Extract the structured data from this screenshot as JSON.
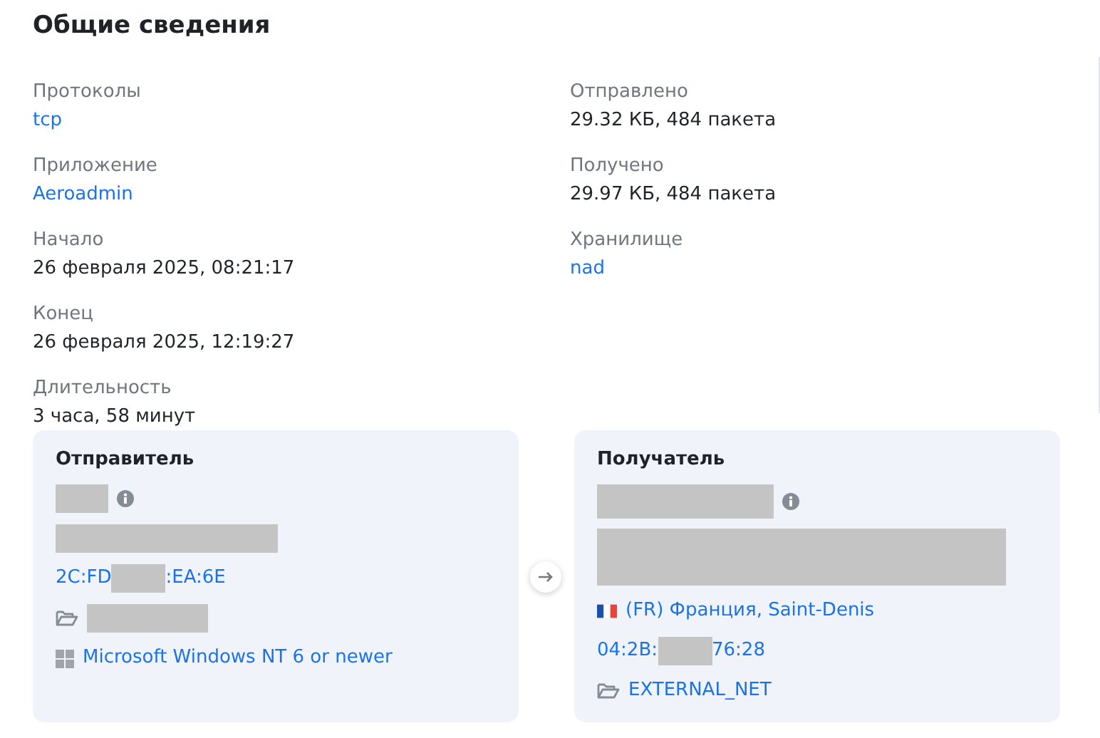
{
  "title": "Общие сведения",
  "columns": [
    [
      {
        "label": "Протоколы",
        "value": "tcp",
        "kind": "link"
      },
      {
        "label": "Приложение",
        "value": "Aeroadmin",
        "kind": "link"
      },
      {
        "label": "Начало",
        "value": "26 февраля 2025, 08:21:17",
        "kind": "text"
      },
      {
        "label": "Конец",
        "value": "26 февраля 2025, 12:19:27",
        "kind": "text"
      },
      {
        "label": "Длительность",
        "value": "3 часа, 58 минут",
        "kind": "text"
      }
    ],
    [
      {
        "label": "Отправлено",
        "value": "29.32 КБ, 484 пакета",
        "kind": "text"
      },
      {
        "label": "Получено",
        "value": "29.97 КБ, 484 пакета",
        "kind": "text"
      },
      {
        "label": "Хранилище",
        "value": "nad",
        "kind": "link"
      }
    ]
  ],
  "endpoints": [
    {
      "title": "Отправитель",
      "lines": [
        {
          "kind": "name"
        },
        {
          "kind": "address"
        },
        {
          "kind": "mac",
          "prefix": "2C:FD",
          "suffix": ":EA:6E"
        },
        {
          "kind": "folder",
          "redacted": true
        },
        {
          "kind": "os",
          "text": "Microsoft Windows NT 6 or newer"
        }
      ]
    },
    {
      "title": "Получатель",
      "lines": [
        {
          "kind": "name"
        },
        {
          "kind": "address"
        },
        {
          "kind": "geo",
          "text": "(FR) Франция, Saint-Denis"
        },
        {
          "kind": "mac",
          "prefix": "04:2B:",
          "suffix": "76:28"
        },
        {
          "kind": "folder",
          "redacted": false,
          "text": "EXTERNAL_NET"
        }
      ]
    }
  ]
}
